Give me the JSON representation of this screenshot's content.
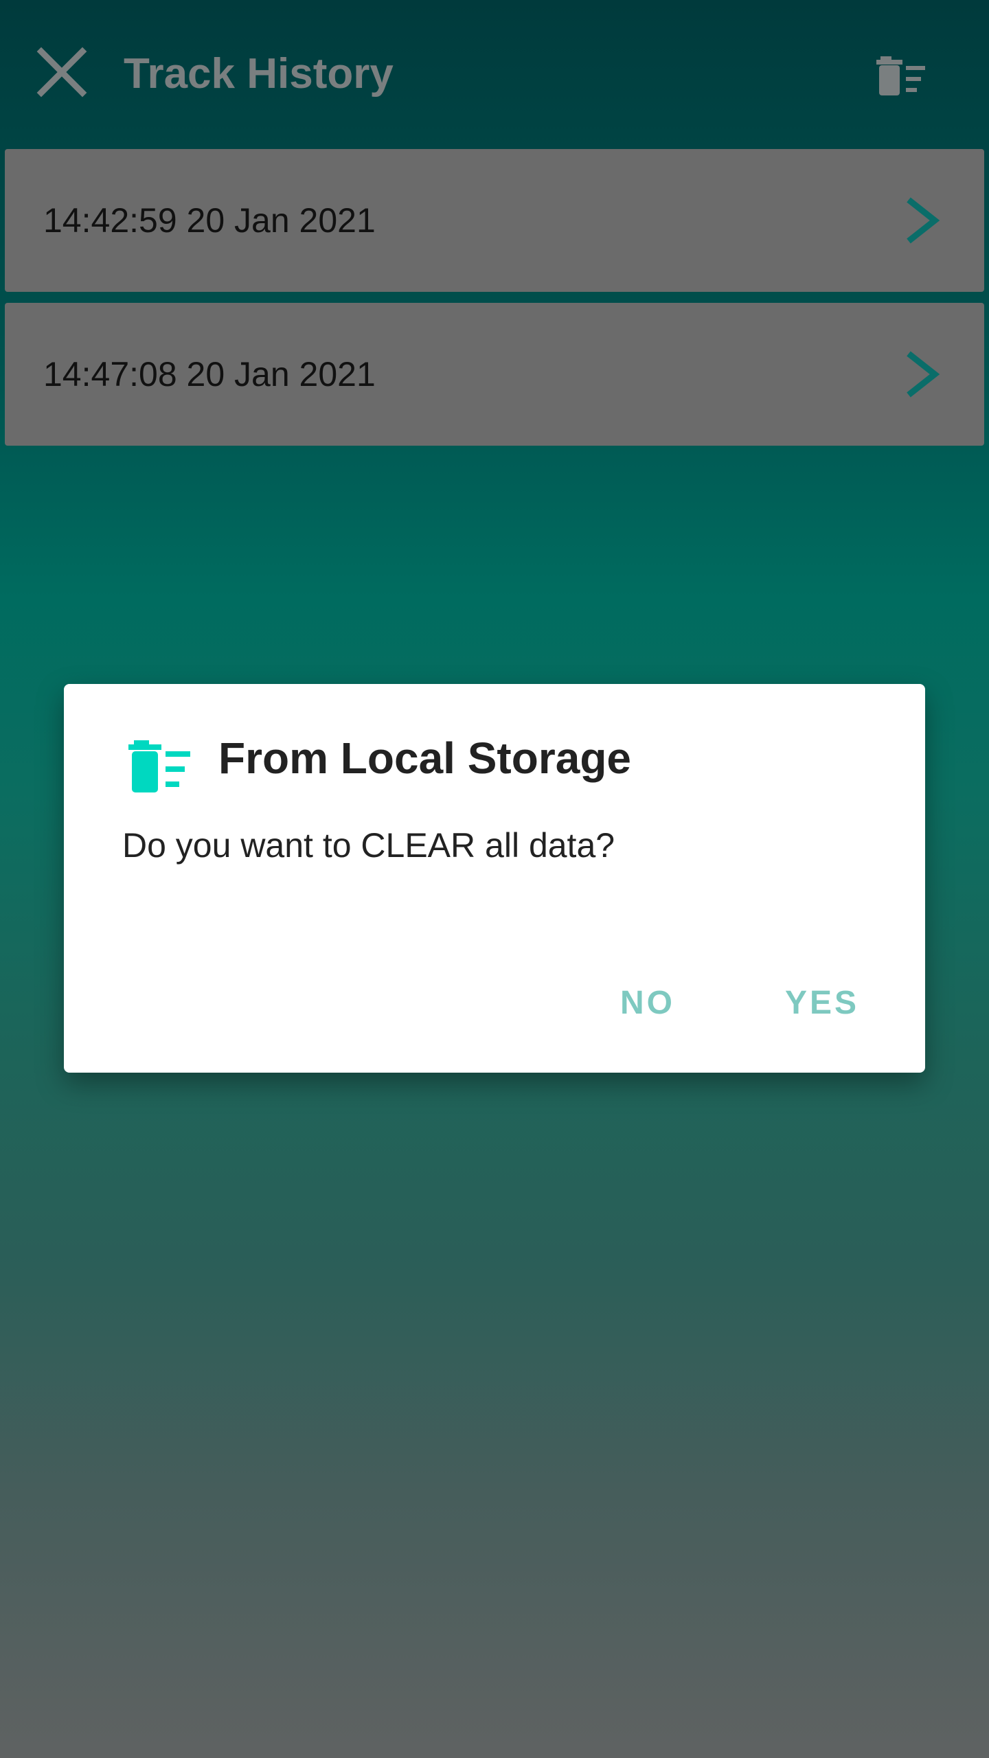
{
  "header": {
    "title": "Track History",
    "close_icon": "close-icon",
    "clear_icon": "delete-sweep-icon"
  },
  "tracks": [
    {
      "label": "14:42:59 20 Jan 2021"
    },
    {
      "label": "14:47:08 20 Jan 2021"
    }
  ],
  "dialog": {
    "icon": "delete-sweep-icon",
    "title": "From Local Storage",
    "message": "Do you want to CLEAR all data?",
    "no_label": "NO",
    "yes_label": "YES"
  },
  "colors": {
    "accent": "#00d8c0",
    "chevron": "#0a6d69",
    "button_text": "#7ec9c0",
    "row_background": "#6b6b6b",
    "header_text": "#7a7f80"
  }
}
